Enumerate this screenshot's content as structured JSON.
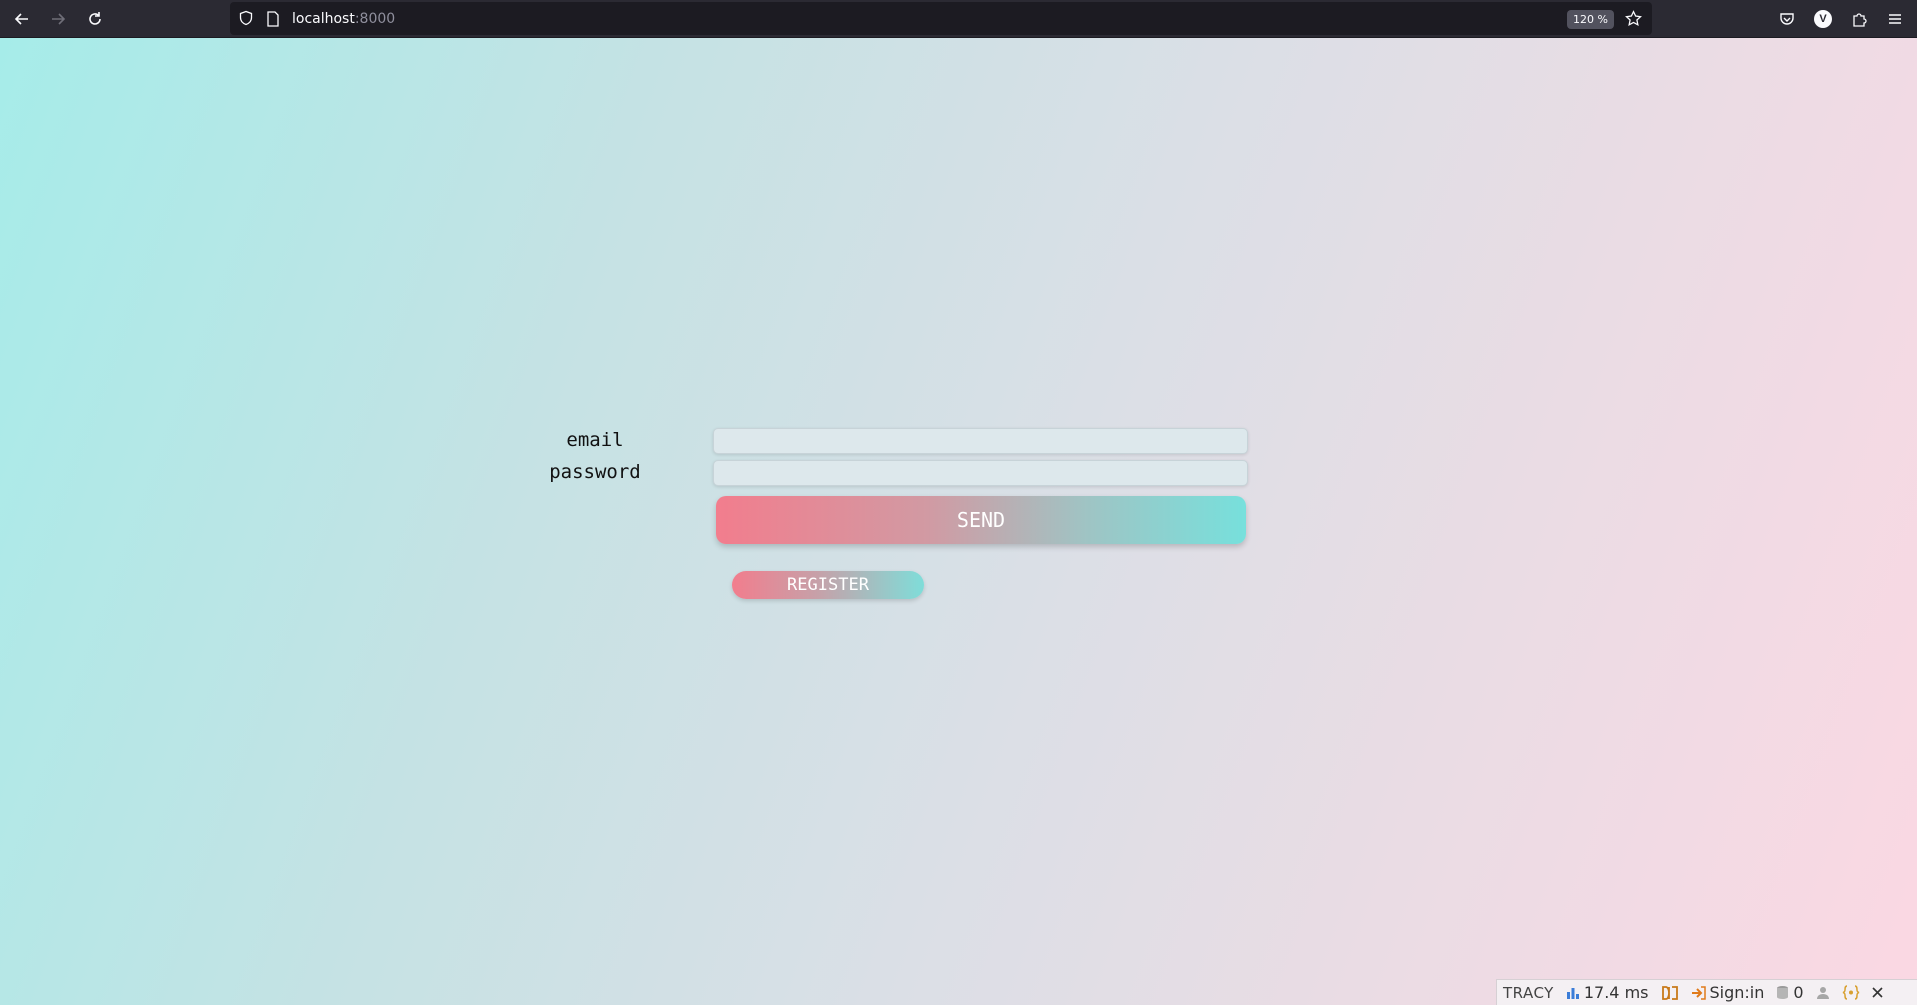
{
  "browser": {
    "url_host": "localhost",
    "url_port": ":8000",
    "zoom": "120 %",
    "profile_initial": "V"
  },
  "form": {
    "email_label": "email",
    "password_label": "password",
    "send_label": "SEND",
    "register_label": "REGISTER",
    "email_value": "",
    "password_value": ""
  },
  "tracy": {
    "logo": "TRACY",
    "time": "17.4 ms",
    "signin": "Sign:in",
    "db_count": "0"
  },
  "colors": {
    "gradient_start": "#f27d8d",
    "gradient_end": "#77e0dc",
    "bg_left": "#a6ece9",
    "bg_right": "#fbd8e3"
  }
}
